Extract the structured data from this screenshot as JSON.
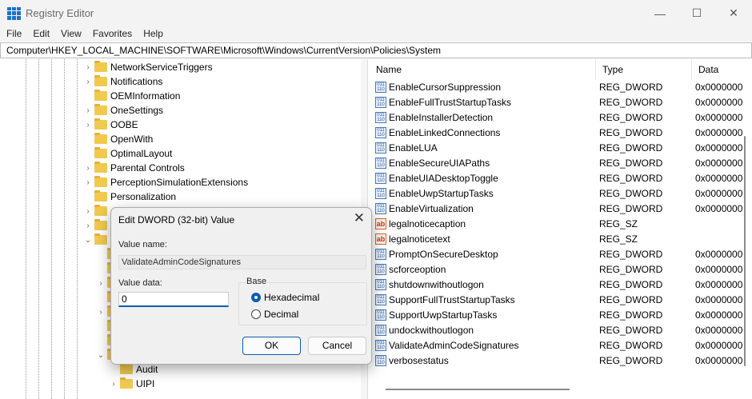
{
  "window": {
    "title": "Registry Editor",
    "minimize": "—",
    "maximize": "☐",
    "close": "✕"
  },
  "menu": [
    "File",
    "Edit",
    "View",
    "Favorites",
    "Help"
  ],
  "address": "Computer\\HKEY_LOCAL_MACHINE\\SOFTWARE\\Microsoft\\Windows\\CurrentVersion\\Policies\\System",
  "tree": [
    {
      "label": "NetworkServiceTriggers",
      "expander": "collapsed"
    },
    {
      "label": "Notifications",
      "expander": "collapsed"
    },
    {
      "label": "OEMInformation",
      "expander": "none"
    },
    {
      "label": "OneSettings",
      "expander": "collapsed"
    },
    {
      "label": "OOBE",
      "expander": "collapsed"
    },
    {
      "label": "OpenWith",
      "expander": "none"
    },
    {
      "label": "OptimalLayout",
      "expander": "none"
    },
    {
      "label": "Parental Controls",
      "expander": "collapsed"
    },
    {
      "label": "PerceptionSimulationExtensions",
      "expander": "collapsed"
    },
    {
      "label": "Personalization",
      "expander": "none"
    }
  ],
  "tree_children": [
    {
      "label": "Audit",
      "expander": "none"
    },
    {
      "label": "UIPI",
      "expander": "collapsed"
    }
  ],
  "columns": {
    "name": "Name",
    "type": "Type",
    "data": "Data"
  },
  "values": [
    {
      "name": "EnableCursorSuppression",
      "type": "REG_DWORD",
      "data": "0x0000000",
      "icon": "dword"
    },
    {
      "name": "EnableFullTrustStartupTasks",
      "type": "REG_DWORD",
      "data": "0x0000000",
      "icon": "dword"
    },
    {
      "name": "EnableInstallerDetection",
      "type": "REG_DWORD",
      "data": "0x0000000",
      "icon": "dword"
    },
    {
      "name": "EnableLinkedConnections",
      "type": "REG_DWORD",
      "data": "0x0000000",
      "icon": "dword"
    },
    {
      "name": "EnableLUA",
      "type": "REG_DWORD",
      "data": "0x0000000",
      "icon": "dword"
    },
    {
      "name": "EnableSecureUIAPaths",
      "type": "REG_DWORD",
      "data": "0x0000000",
      "icon": "dword"
    },
    {
      "name": "EnableUIADesktopToggle",
      "type": "REG_DWORD",
      "data": "0x0000000",
      "icon": "dword"
    },
    {
      "name": "EnableUwpStartupTasks",
      "type": "REG_DWORD",
      "data": "0x0000000",
      "icon": "dword"
    },
    {
      "name": "EnableVirtualization",
      "type": "REG_DWORD",
      "data": "0x0000000",
      "icon": "dword"
    },
    {
      "name": "legalnoticecaption",
      "type": "REG_SZ",
      "data": "",
      "icon": "string"
    },
    {
      "name": "legalnoticetext",
      "type": "REG_SZ",
      "data": "",
      "icon": "string"
    },
    {
      "name": "PromptOnSecureDesktop",
      "type": "REG_DWORD",
      "data": "0x0000000",
      "icon": "dword"
    },
    {
      "name": "scforceoption",
      "type": "REG_DWORD",
      "data": "0x0000000",
      "icon": "dword"
    },
    {
      "name": "shutdownwithoutlogon",
      "type": "REG_DWORD",
      "data": "0x0000000",
      "icon": "dword"
    },
    {
      "name": "SupportFullTrustStartupTasks",
      "type": "REG_DWORD",
      "data": "0x0000000",
      "icon": "dword"
    },
    {
      "name": "SupportUwpStartupTasks",
      "type": "REG_DWORD",
      "data": "0x0000000",
      "icon": "dword"
    },
    {
      "name": "undockwithoutlogon",
      "type": "REG_DWORD",
      "data": "0x0000000",
      "icon": "dword"
    },
    {
      "name": "ValidateAdminCodeSignatures",
      "type": "REG_DWORD",
      "data": "0x0000000",
      "icon": "dword"
    },
    {
      "name": "verbosestatus",
      "type": "REG_DWORD",
      "data": "0x0000000",
      "icon": "dword"
    }
  ],
  "dialog": {
    "title": "Edit DWORD (32-bit) Value",
    "close": "✕",
    "value_name_label": "Value name:",
    "value_name": "ValidateAdminCodeSignatures",
    "value_data_label": "Value data:",
    "value_data": "0",
    "base_label": "Base",
    "hex_label": "Hexadecimal",
    "dec_label": "Decimal",
    "base_selected": "Hexadecimal",
    "ok": "OK",
    "cancel": "Cancel"
  },
  "colors": {
    "accent": "#0b5cad",
    "folder": "#f1c94f"
  }
}
